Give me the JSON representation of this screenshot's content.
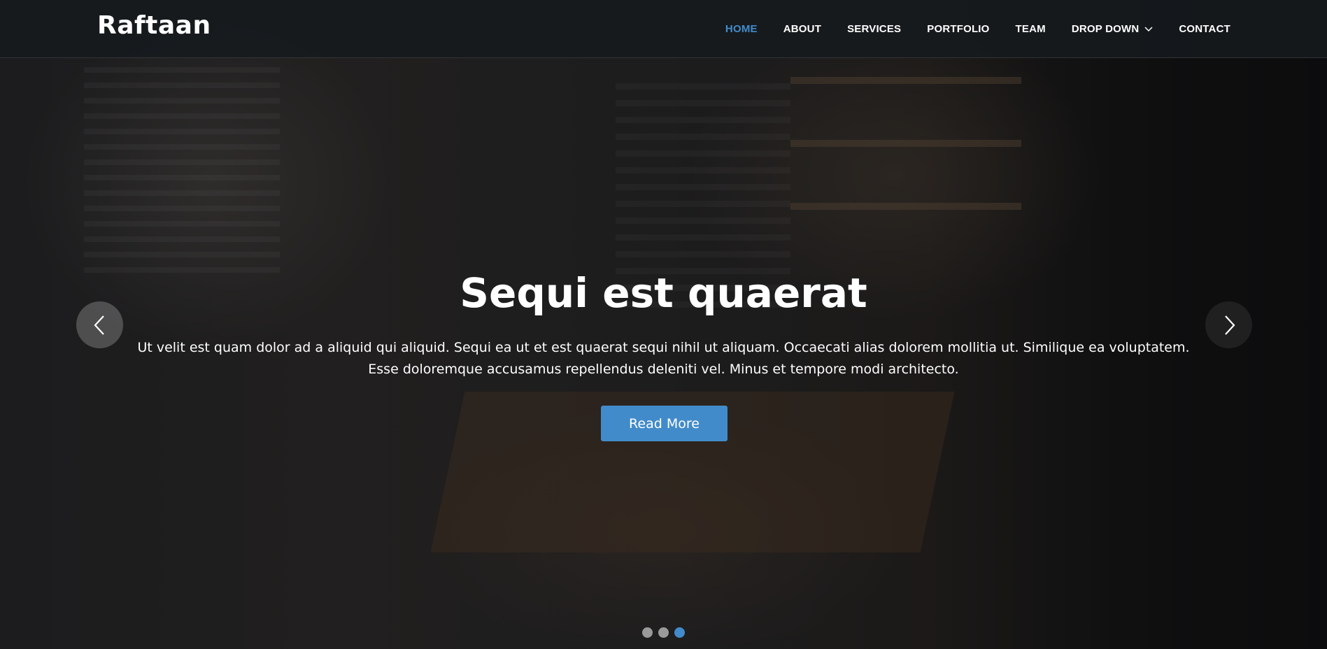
{
  "brand": {
    "name": "Raftaan"
  },
  "nav": {
    "items": [
      {
        "label": "HOME",
        "active": true
      },
      {
        "label": "ABOUT"
      },
      {
        "label": "SERVICES"
      },
      {
        "label": "PORTFOLIO"
      },
      {
        "label": "TEAM"
      },
      {
        "label": "DROP DOWN",
        "icon": "chevron-down-icon"
      },
      {
        "label": "CONTACT"
      }
    ]
  },
  "hero": {
    "title": "Sequi est quaerat",
    "description": "Ut velit est quam dolor ad a aliquid qui aliquid. Sequi ea ut et est quaerat sequi nihil ut aliquam. Occaecati alias dolorem mollitia ut. Similique ea voluptatem. Esse doloremque accusamus repellendus deleniti vel. Minus et tempore modi architecto.",
    "button_label": "Read More",
    "prev_icon": "chevron-left-icon",
    "next_icon": "chevron-right-icon",
    "slides_total": 3,
    "active_slide": 3
  },
  "colors": {
    "accent": "#428bca",
    "header_bg": "#161a1e",
    "text": "#ffffff",
    "dot_inactive": "#9a9a9a"
  }
}
